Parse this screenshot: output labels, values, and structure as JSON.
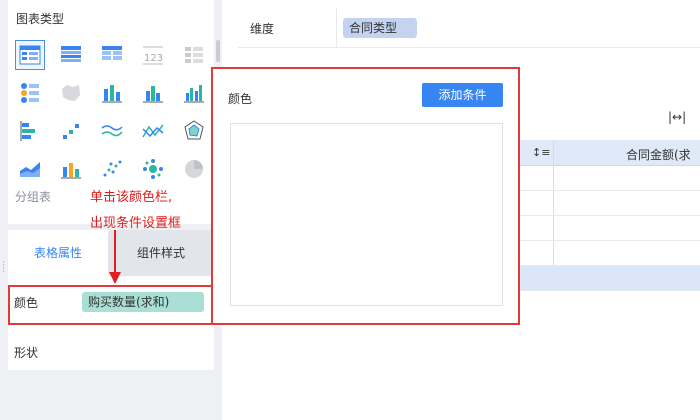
{
  "chart_panel": {
    "title": "图表类型",
    "icons": [
      "group-table-icon",
      "cross-table-icon",
      "detail-table-icon",
      "kpi-card-icon",
      "hidden-icon",
      "dot-list-icon",
      "map-icon",
      "stacked-bar-icon",
      "column-chart-icon",
      "grouped-column-icon",
      "horizontal-bar-icon",
      "step-bar-icon",
      "multi-line-icon",
      "line-chart-icon",
      "radar-icon",
      "area-chart-icon",
      "combo-chart-icon",
      "scatter-icon",
      "bubble-icon",
      "pie-icon"
    ],
    "current_type": "分组表"
  },
  "annotation": {
    "line1": "单击该颜色栏,",
    "line2": "出现条件设置框"
  },
  "tabs": {
    "table_props": "表格属性",
    "component_style": "组件样式"
  },
  "props": {
    "color_label": "颜色",
    "color_field": "购买数量(求和)",
    "shape_label": "形状"
  },
  "dimension": {
    "label": "维度",
    "field": "合同类型"
  },
  "table": {
    "expand": "|↔|",
    "sort_icon": "↕≡",
    "column": "合同金额(求"
  },
  "popup": {
    "title": "颜色",
    "add_button": "添加条件"
  },
  "colors": {
    "accent": "#3685f2",
    "highlight_red": "#e03a3a",
    "measure_pill": "#a9dfd4",
    "dimension_pill": "#c4d3f0"
  }
}
